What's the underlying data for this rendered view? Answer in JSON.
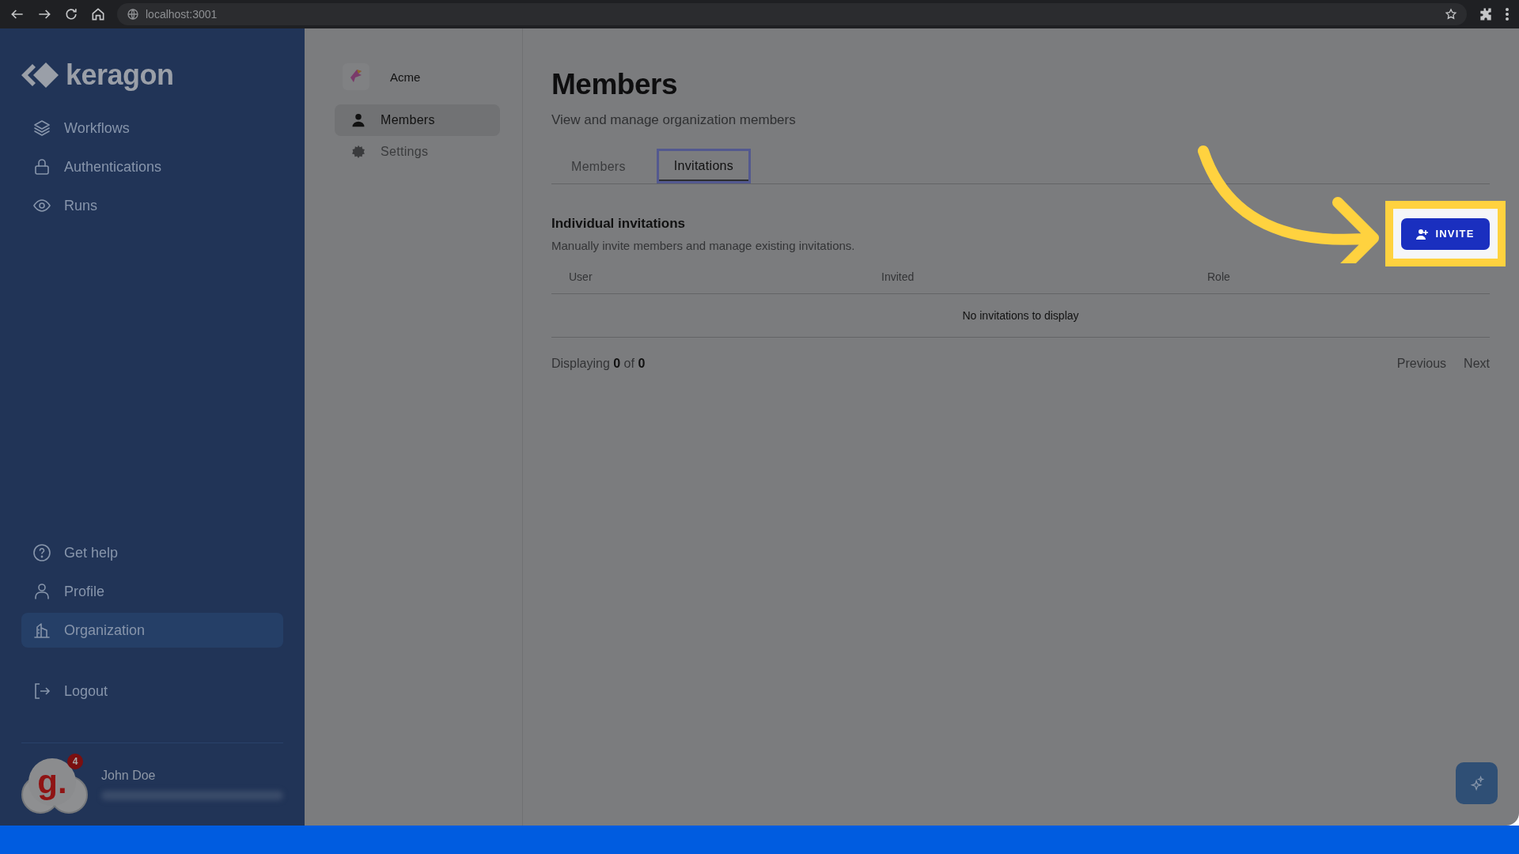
{
  "browser": {
    "url": "localhost:3001"
  },
  "sidebar": {
    "brand": "keragon",
    "items": [
      {
        "label": "Workflows",
        "kind": "layers",
        "selected": false
      },
      {
        "label": "Authentications",
        "kind": "lock",
        "selected": false
      },
      {
        "label": "Runs",
        "kind": "eye",
        "selected": false
      }
    ],
    "bottom_items": [
      {
        "label": "Get help",
        "kind": "help",
        "selected": false
      },
      {
        "label": "Profile",
        "kind": "person",
        "selected": false
      },
      {
        "label": "Organization",
        "kind": "building",
        "selected": true
      }
    ],
    "logout": "Logout",
    "user": {
      "name": "John Doe",
      "avatar_letter": "g.",
      "badge": "4"
    }
  },
  "org_menu": {
    "org_name": "Acme",
    "items": [
      {
        "label": "Members",
        "kind": "person",
        "selected": true
      },
      {
        "label": "Settings",
        "kind": "gear",
        "selected": false
      }
    ]
  },
  "page": {
    "title": "Members",
    "subtitle": "View and manage organization members",
    "tabs": [
      {
        "label": "Members",
        "selected": false
      },
      {
        "label": "Invitations",
        "selected": true
      }
    ],
    "section_title": "Individual invitations",
    "section_description": "Manually invite members and manage existing invitations.",
    "invite_button": "INVITE",
    "table": {
      "columns": [
        "User",
        "Invited",
        "Role"
      ],
      "empty_message": "No invitations to display"
    },
    "pagination": {
      "summary": "Displaying **0** of **0**",
      "previous": "Previous",
      "next": "Next"
    }
  }
}
